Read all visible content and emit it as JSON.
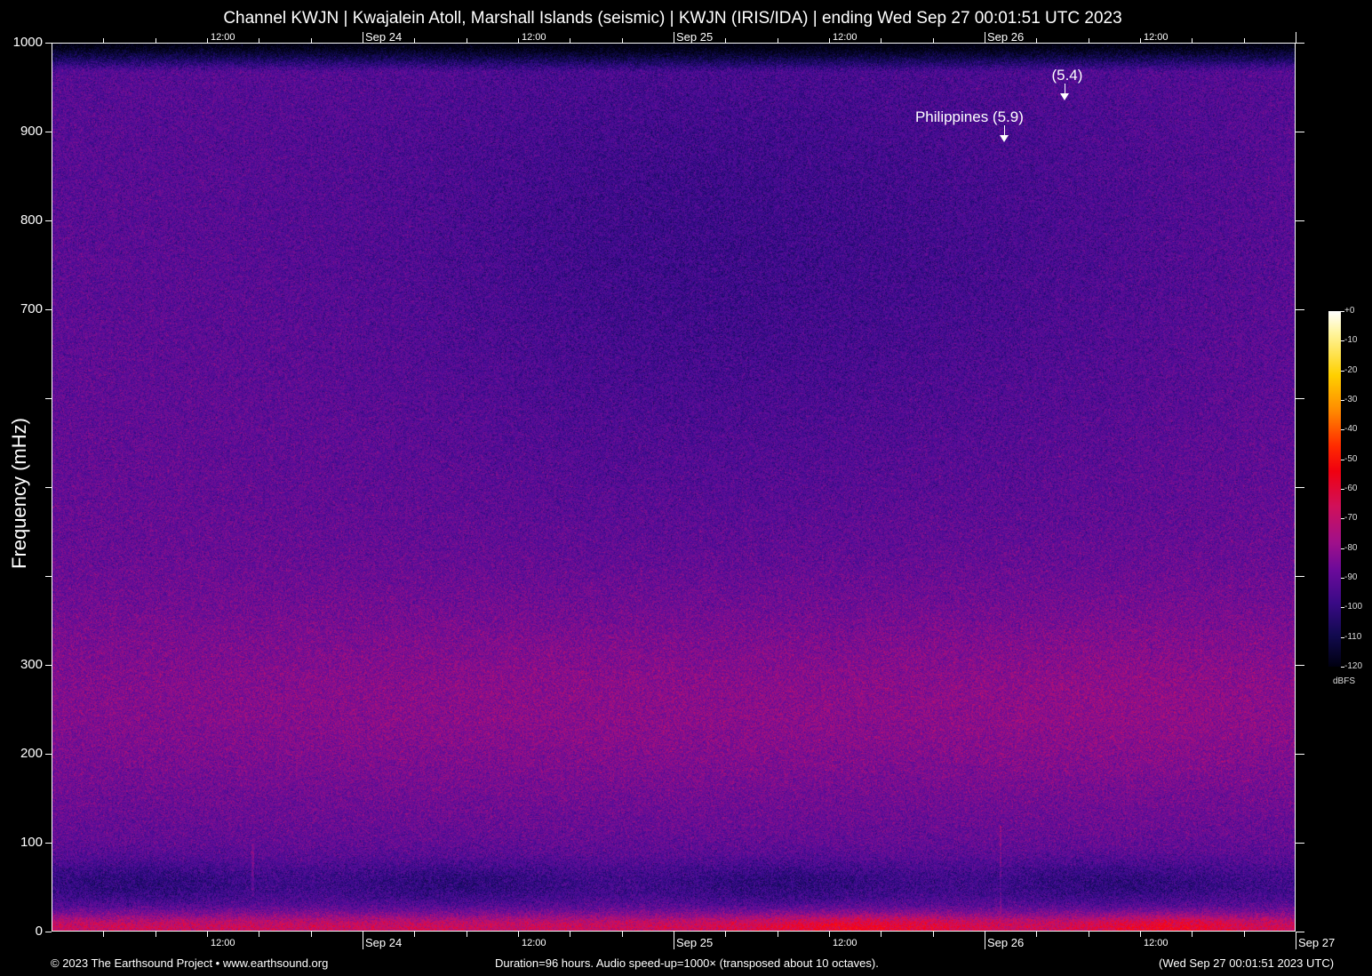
{
  "title": "Channel KWJN | Kwajalein Atoll, Marshall Islands (seismic) | KWJN (IRIS/IDA) | ending Wed Sep 27 00:01:51 UTC 2023",
  "footer": {
    "copyright": "© 2023 The Earthsound Project • www.earthsound.org",
    "duration": "Duration=96 hours. Audio speed-up=1000× (transposed about 10 octaves).",
    "end_time": "(Wed Sep 27 00:01:51 2023 UTC)"
  },
  "chart_data": {
    "type": "heatmap",
    "title": "Channel KWJN | Kwajalein Atoll, Marshall Islands (seismic) | KWJN (IRIS/IDA) | ending Wed Sep 27 00:01:51 UTC 2023",
    "ylabel": "Frequency (mHz)",
    "xlabel": "",
    "ylim": [
      0,
      1000
    ],
    "y_ticks": [
      0,
      100,
      200,
      300,
      400,
      500,
      600,
      700,
      800,
      900,
      1000
    ],
    "y_tick_labels": [
      "0",
      "100",
      "200",
      "300",
      "",
      "",
      "",
      "700",
      "800",
      "900",
      "1000"
    ],
    "x_range_hours": [
      0,
      96
    ],
    "x_tick_step_hours": 4,
    "x_tick_labels": [
      {
        "hour": 12,
        "label": "12:00"
      },
      {
        "hour": 24,
        "label": "Sep 24"
      },
      {
        "hour": 36,
        "label": "12:00"
      },
      {
        "hour": 48,
        "label": "Sep 25"
      },
      {
        "hour": 60,
        "label": "12:00"
      },
      {
        "hour": 72,
        "label": "Sep 26"
      },
      {
        "hour": 84,
        "label": "12:00"
      },
      {
        "hour": 96,
        "label": "Sep 27"
      }
    ],
    "colorbar": {
      "label": "dBFS",
      "range": [
        -120,
        0
      ],
      "ticks": [
        "+0",
        "-10",
        "-20",
        "-30",
        "-40",
        "-50",
        "-60",
        "-70",
        "-80",
        "-90",
        "-100",
        "-110",
        "-120"
      ]
    },
    "annotations": [
      {
        "label": "Philippines (5.9)",
        "hour": 73.5,
        "freq_mHz": 890
      },
      {
        "label": "(5.4)",
        "hour": 78.2,
        "freq_mHz": 937
      }
    ]
  }
}
